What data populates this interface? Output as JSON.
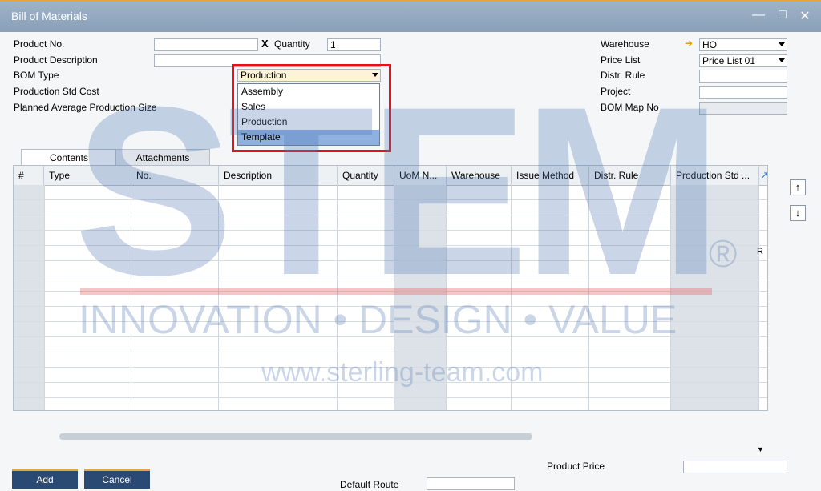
{
  "window": {
    "title": "Bill of Materials"
  },
  "header_left": {
    "product_no_label": "Product No.",
    "product_no_value": "",
    "quantity_label": "Quantity",
    "quantity_value": "1",
    "product_desc_label": "Product Description",
    "product_desc_value": "",
    "bom_type_label": "BOM Type",
    "bom_type_value": "Production",
    "std_cost_label": "Production Std Cost",
    "avg_size_label": "Planned Average Production Size"
  },
  "bom_type_dropdown": {
    "options": [
      "Assembly",
      "Sales",
      "Production",
      "Template"
    ],
    "highlighted": "Template"
  },
  "header_right": {
    "warehouse_label": "Warehouse",
    "warehouse_value": "HO",
    "price_list_label": "Price List",
    "price_list_value": "Price List 01",
    "distr_rule_label": "Distr. Rule",
    "project_label": "Project",
    "bom_map_label": "BOM Map No"
  },
  "tabs": [
    "Contents",
    "Attachments"
  ],
  "grid": {
    "columns": [
      "#",
      "Type",
      "No.",
      "Description",
      "Quantity",
      "UoM N...",
      "Warehouse",
      "Issue Method",
      "Distr. Rule",
      "Production Std ..."
    ],
    "corner_marker": "R"
  },
  "footer": {
    "add_label": "Add",
    "cancel_label": "Cancel",
    "product_price_label": "Product Price",
    "default_route_label": "Default Route"
  },
  "watermark": {
    "big": "STEM",
    "reg": "®",
    "tagline": "INNOVATION • DESIGN • VALUE",
    "url": "www.sterling-team.com"
  },
  "colors": {
    "accent": "#e8a53a",
    "highlight_box": "#e2111a",
    "button": "#2a4a73",
    "selection": "#8fb1e0"
  }
}
